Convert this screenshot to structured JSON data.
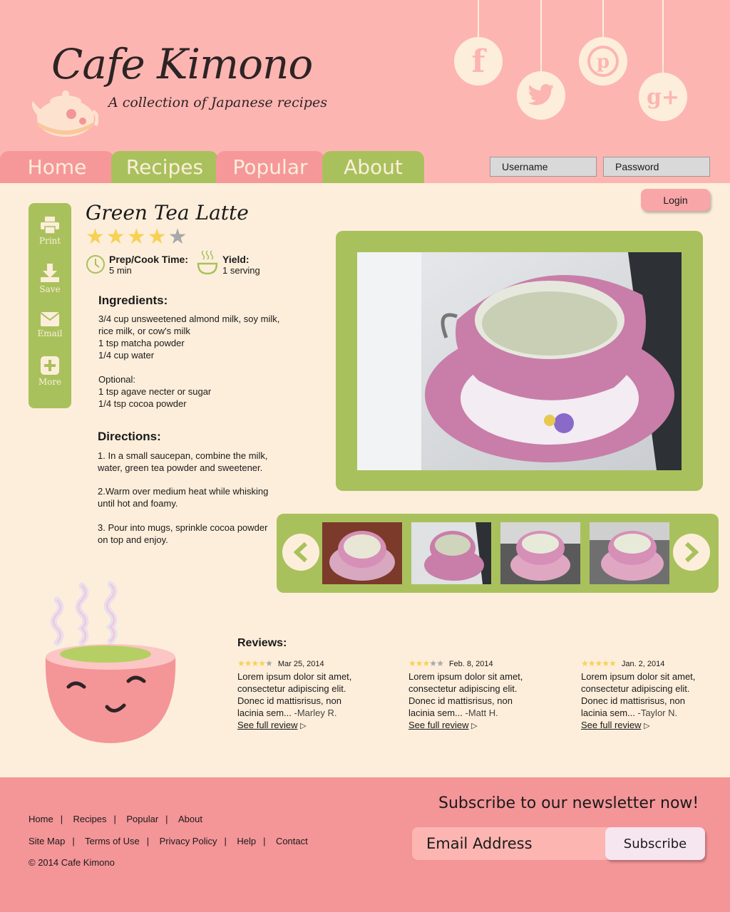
{
  "brand": {
    "title": "Cafe Kimono",
    "tagline": "A collection of Japanese recipes"
  },
  "social": {
    "facebook": "f",
    "twitter": "t",
    "pinterest": "p",
    "googleplus": "g+"
  },
  "nav": {
    "tabs": [
      {
        "label": "Home"
      },
      {
        "label": "Recipes"
      },
      {
        "label": "Popular"
      },
      {
        "label": "About"
      }
    ]
  },
  "login": {
    "username_placeholder": "Username",
    "password_placeholder": "Password",
    "button": "Login"
  },
  "sidebar": {
    "items": [
      {
        "label": "Print",
        "icon": "print-icon"
      },
      {
        "label": "Save",
        "icon": "save-icon"
      },
      {
        "label": "Email",
        "icon": "email-icon"
      },
      {
        "label": "More",
        "icon": "plus-icon"
      }
    ]
  },
  "recipe": {
    "title": "Green Tea Latte",
    "rating": 4,
    "rating_max": 5,
    "prep_label": "Prep/Cook Time:",
    "prep_value": "5 min",
    "yield_label": "Yield:",
    "yield_value": "1 serving",
    "ingredients_title": "Ingredients:",
    "ingredients_text": "3/4 cup unsweetened almond milk, soy milk,\nrice milk, or cow's milk\n1 tsp matcha powder\n1/4 cup water\n\nOptional:\n1 tsp agave necter or sugar\n1/4 tsp cocoa powder",
    "directions_title": "Directions:",
    "directions": [
      "1. In a small saucepan, combine the milk, water, green tea powder and sweetener.",
      "2.Warm over medium heat while whisking until hot and foamy.",
      "3. Pour into mugs, sprinkle cocoa powder on top and enjoy."
    ]
  },
  "reviews": {
    "title": "Reviews:",
    "items": [
      {
        "rating": 4,
        "date": "Mar 25, 2014",
        "text": "Lorem ipsum dolor sit amet, consectetur adipiscing elit. Donec id mattisrisus, non lacinia sem...",
        "author": "-Marley R.",
        "link": "See full review"
      },
      {
        "rating": 3,
        "date": "Feb. 8, 2014",
        "text": "Lorem ipsum dolor sit amet, consectetur adipiscing elit. Donec id mattisrisus, non lacinia sem...",
        "author": "-Matt H.",
        "link": "See full review"
      },
      {
        "rating": 5,
        "date": "Jan. 2, 2014",
        "text": "Lorem ipsum dolor sit amet, consectetur adipiscing elit. Donec id mattisrisus, non lacinia sem...",
        "author": "-Taylor N.",
        "link": "See full review"
      }
    ]
  },
  "footer": {
    "links_row1": [
      "Home",
      "Recipes",
      "Popular",
      "About"
    ],
    "links_row2": [
      "Site Map",
      "Terms of Use",
      "Privacy Policy",
      "Help",
      "Contact"
    ],
    "copyright": "© 2014 Cafe Kimono",
    "subscribe_title": "Subscribe to our newsletter now!",
    "email_placeholder": "Email Address",
    "subscribe_button": "Subscribe"
  },
  "colors": {
    "header_pink": "#fdb5b2",
    "tab_pink": "#f6989a",
    "green": "#a9c15c",
    "cream": "#fdeedb",
    "footer_pink": "#f49598",
    "star_gold": "#f7d154",
    "star_gray": "#a8a8a8"
  }
}
